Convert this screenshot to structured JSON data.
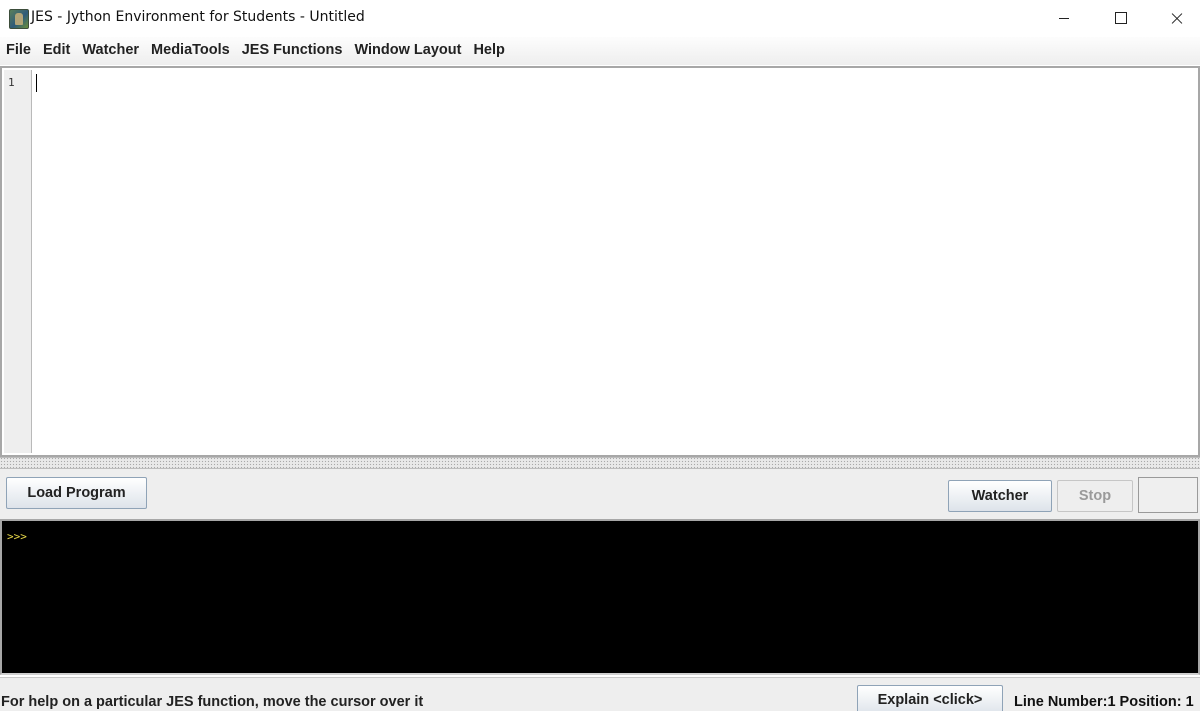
{
  "window": {
    "title": "JES - Jython Environment for Students - Untitled",
    "icon": "jes-app-icon"
  },
  "menu": {
    "items": [
      {
        "label": "File"
      },
      {
        "label": "Edit"
      },
      {
        "label": "Watcher"
      },
      {
        "label": "MediaTools"
      },
      {
        "label": "JES Functions"
      },
      {
        "label": "Window Layout"
      },
      {
        "label": "Help"
      }
    ]
  },
  "editor": {
    "line_numbers": [
      "1"
    ],
    "content": ""
  },
  "controls": {
    "load_program": "Load Program",
    "watcher": "Watcher",
    "stop": "Stop"
  },
  "console": {
    "prompt": ">>>"
  },
  "status": {
    "help_text": "For help on a particular JES function, move the cursor over it",
    "explain_button": "Explain <click>",
    "position_text": "Line Number:1 Position: 1"
  },
  "colors": {
    "console_background": "#000000",
    "prompt_color": "#e8d84a",
    "menu_background": "#eeeeee"
  }
}
